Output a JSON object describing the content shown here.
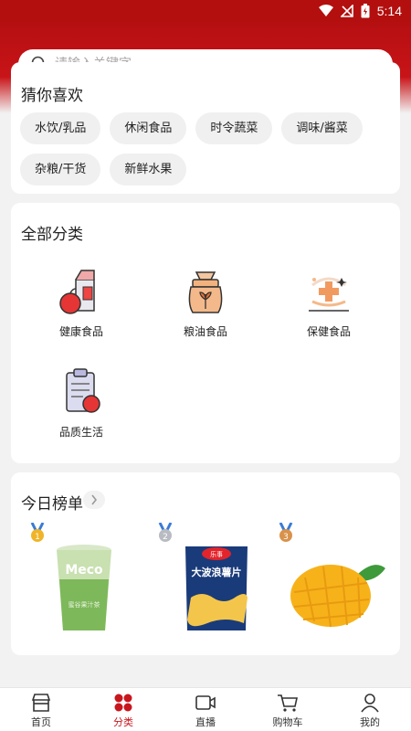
{
  "status": {
    "time": "5:14"
  },
  "search": {
    "placeholder": "请输入关键字"
  },
  "guess": {
    "title": "猜你喜欢",
    "chips": [
      "水饮/乳品",
      "休闲食品",
      "时令蔬菜",
      "调味/酱菜",
      "杂粮/干货",
      "新鲜水果"
    ]
  },
  "categories": {
    "title": "全部分类",
    "items": [
      {
        "label": "健康食品",
        "icon": "milk-carton-apple-icon"
      },
      {
        "label": "粮油食品",
        "icon": "grain-sack-icon"
      },
      {
        "label": "保健食品",
        "icon": "health-cross-icon"
      },
      {
        "label": "品质生活",
        "icon": "quality-clipboard-icon"
      }
    ]
  },
  "ranking": {
    "title": "今日榜单",
    "items": [
      {
        "medal": "1",
        "product": "Meco",
        "product_sub": "蜜谷果汁茶"
      },
      {
        "medal": "2",
        "product": "大波浪薯片",
        "brand": "乐事"
      },
      {
        "medal": "3",
        "product": "mango"
      }
    ]
  },
  "tabbar": {
    "items": [
      {
        "label": "首页",
        "icon": "store-icon"
      },
      {
        "label": "分类",
        "icon": "grid-icon",
        "active": true
      },
      {
        "label": "直播",
        "icon": "video-camera-icon"
      },
      {
        "label": "购物车",
        "icon": "cart-icon"
      },
      {
        "label": "我的",
        "icon": "user-icon"
      }
    ]
  },
  "colors": {
    "brand": "#c8161d",
    "header": "#b30f0f",
    "background": "#f2f2f2"
  }
}
